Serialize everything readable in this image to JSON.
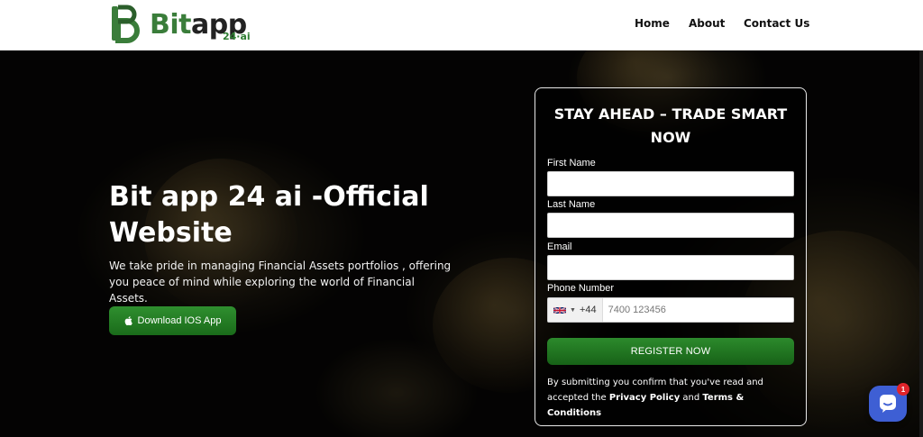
{
  "header": {
    "logo": {
      "brand_part1": "Bit",
      "brand_part2": "app",
      "suffix": "24·ai"
    },
    "nav": [
      {
        "label": "Home"
      },
      {
        "label": "About"
      },
      {
        "label": "Contact Us"
      }
    ]
  },
  "hero": {
    "title": "Bit app 24 ai -Official Website",
    "description": "We take pride in managing Financial Assets portfolios , offering you peace of mind while exploring the world of Financial Assets.",
    "ios_button": {
      "label": "Download IOS App",
      "icon": "apple-icon"
    }
  },
  "form": {
    "title": "STAY AHEAD – TRADE SMART NOW",
    "first_name": {
      "label": "First Name",
      "value": "",
      "placeholder": ""
    },
    "last_name": {
      "label": "Last Name",
      "value": "",
      "placeholder": ""
    },
    "email": {
      "label": "Email",
      "value": "",
      "placeholder": ""
    },
    "phone": {
      "label": "Phone Number",
      "country_code": "+44",
      "flag": "uk-flag",
      "placeholder": "7400 123456"
    },
    "submit_label": "REGISTER NOW",
    "disclaimer_prefix": "By submitting you confirm that you've read and accepted the",
    "privacy_link": "Privacy Policy",
    "disclaimer_and": "and",
    "terms_link": "Terms & Conditions"
  },
  "chat_widget": {
    "badge_count": "1",
    "icon": "chat-icon"
  },
  "colors": {
    "accent_green": "#2e7d32",
    "chat_blue": "#3e5fd4",
    "badge_red": "#e0242b"
  }
}
